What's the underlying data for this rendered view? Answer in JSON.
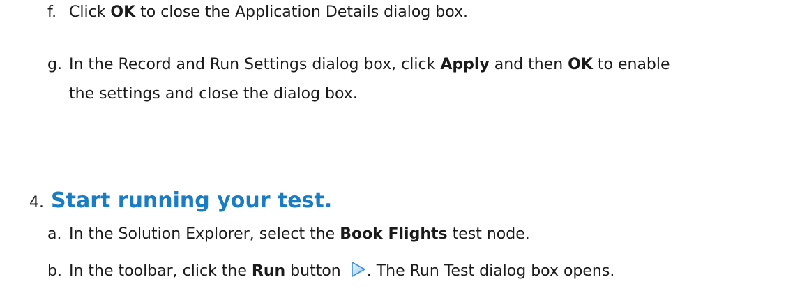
{
  "steps": {
    "f": {
      "letter": "f.",
      "t1": "Click ",
      "b1": "OK",
      "t2": " to close the Application Details dialog box."
    },
    "g": {
      "letter": "g.",
      "t1": "In the Record and Run Settings dialog box, click ",
      "b1": "Apply",
      "t2": " and then ",
      "b2": "OK",
      "t3": " to enable",
      "line2": "the settings and close the dialog box."
    }
  },
  "section": {
    "number": "4.",
    "title": "Start running your test."
  },
  "substeps": {
    "a": {
      "letter": "a.",
      "t1": "In the Solution Explorer, select the ",
      "b1": "Book Flights",
      "t2": " test node."
    },
    "b": {
      "letter": "b.",
      "t1": "In the toolbar, click the ",
      "b1": "Run",
      "t2": " button ",
      "icon": "run-play-icon",
      "t3": ". The Run Test dialog box opens."
    }
  },
  "colors": {
    "heading": "#1a7cc2",
    "text": "#1a1a1a"
  }
}
